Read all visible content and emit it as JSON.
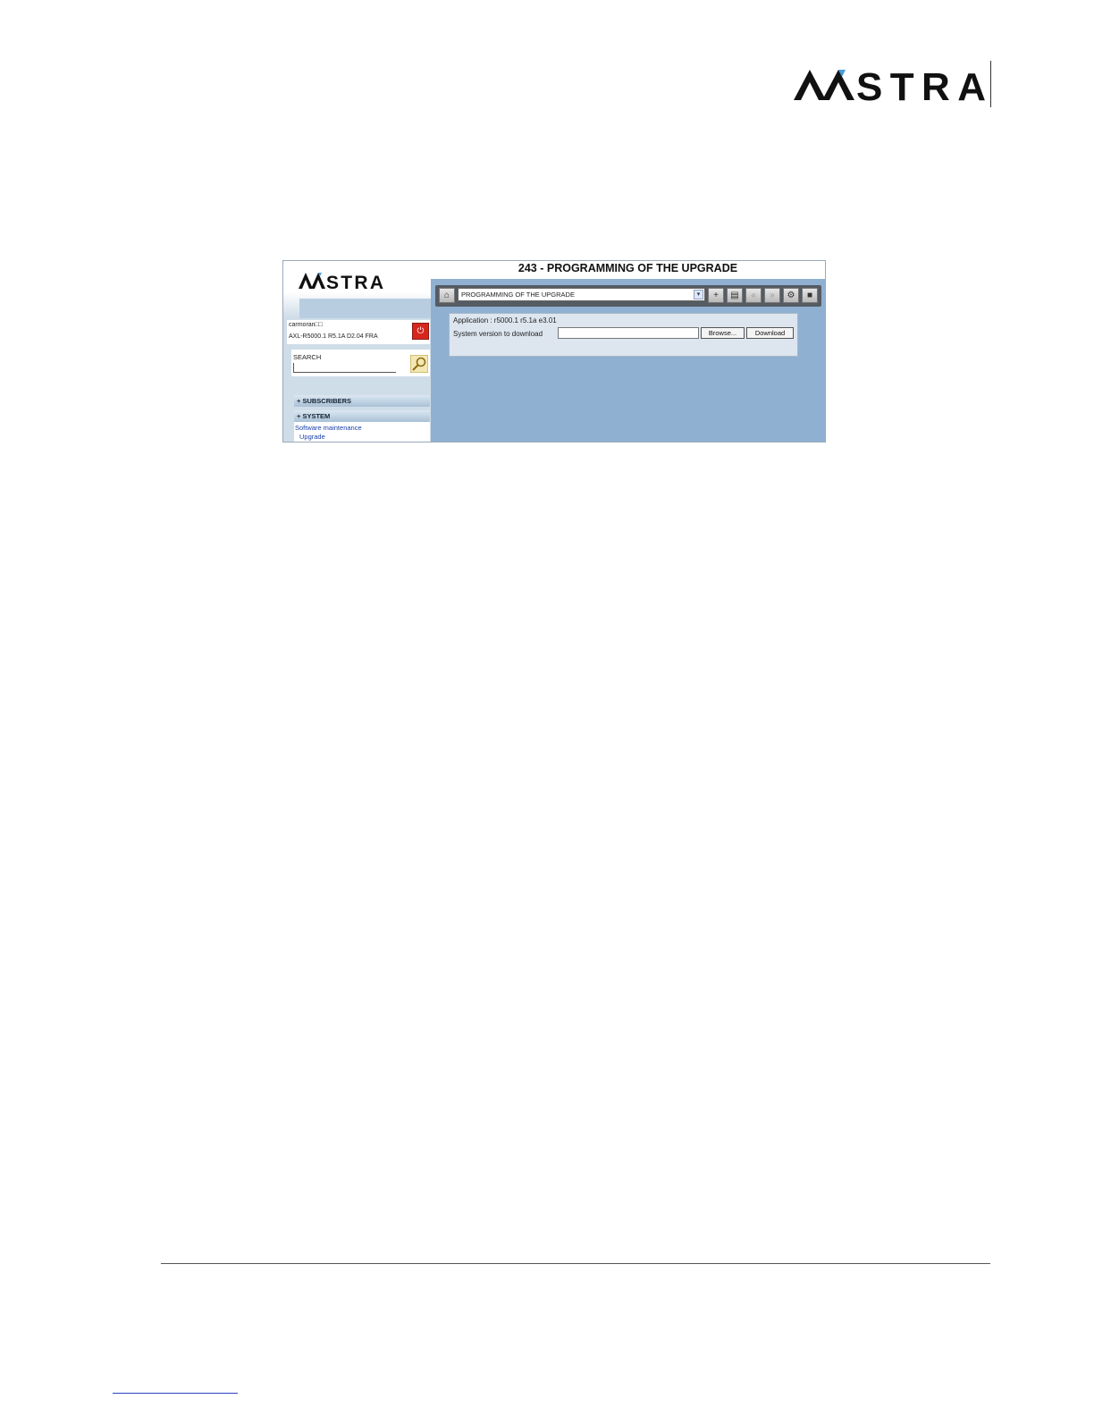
{
  "page": {
    "logo_text": "AASTRA"
  },
  "screenshot": {
    "logo_text": "AASTRA",
    "title": "243 - PROGRAMMING OF THE UPGRADE",
    "user": {
      "name": "carmoran□□",
      "version": "AXL-R5000.1 R5.1A D2.04 FRA"
    },
    "search": {
      "label": "SEARCH",
      "value": ""
    },
    "menu": {
      "sections": [
        "SUBSCRIBERS",
        "SYSTEM"
      ],
      "sub_item": "Software maintenance",
      "sub_sub_item": "Upgrade"
    },
    "toolbar": {
      "selected_page": "PROGRAMMING OF THE UPGRADE",
      "icons": [
        "home-icon",
        "add-icon",
        "folder-icon",
        "previous-icon",
        "next-icon",
        "tools-icon",
        "save-icon"
      ]
    },
    "form": {
      "application": "Application : r5000.1 r5.1a e3.01",
      "field_label": "System version to download",
      "browse_label": "Browse...",
      "download_label": "Download"
    },
    "colors": {
      "content_bg": "#8fb0d1",
      "sidebar_bg": "#cfdde9",
      "toolbar_bg": "#555b62",
      "logout": "#d7261e",
      "link": "#1a3fa8"
    }
  }
}
